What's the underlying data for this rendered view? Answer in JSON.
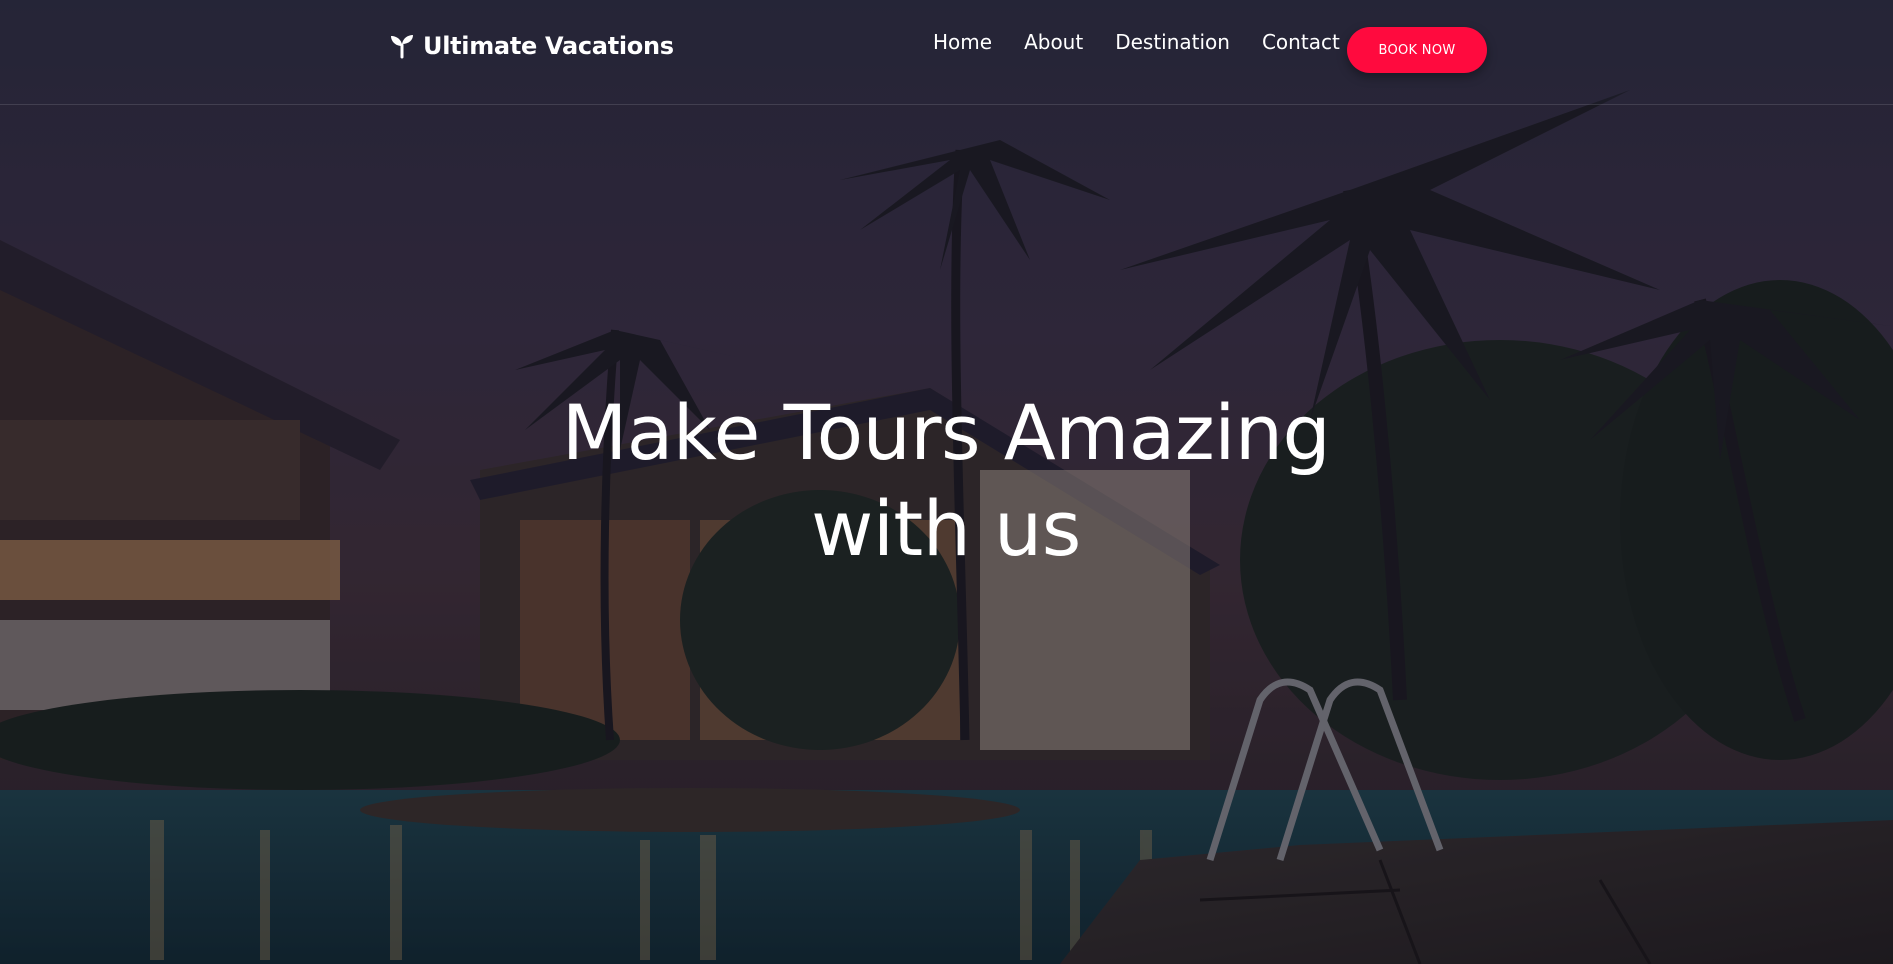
{
  "brand": {
    "name": "Ultimate Vacations",
    "icon": "sprout-icon"
  },
  "nav": {
    "items": [
      {
        "label": "Home"
      },
      {
        "label": "About"
      },
      {
        "label": "Destination"
      },
      {
        "label": "Contact"
      }
    ],
    "cta_label": "BOOK NOW"
  },
  "hero": {
    "headline_line1": "Make Tours Amazing",
    "headline_line2": "with us",
    "background": "resort-pool-night-photo"
  },
  "colors": {
    "accent": "#ff0a3e",
    "text": "#ffffff"
  }
}
